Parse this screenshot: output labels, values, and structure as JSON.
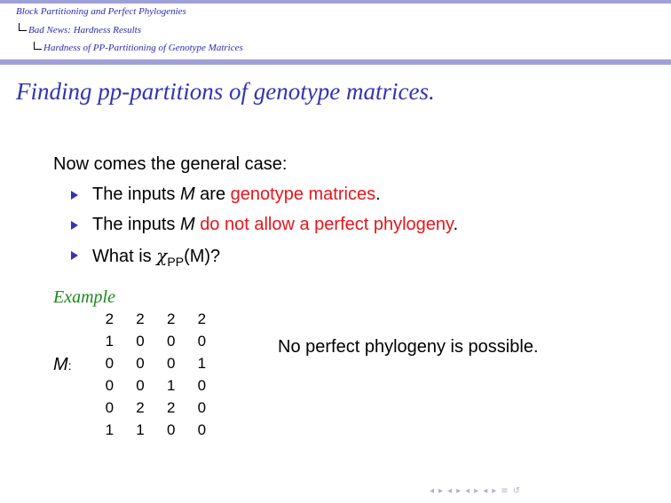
{
  "header": {
    "section": "Block Partitioning and Perfect Phylogenies",
    "subsection": "Bad News: Hardness Results",
    "subsubsection": "Hardness of PP-Partitioning of Genotype Matrices"
  },
  "colors": {
    "header_bar": "#a0a0d8",
    "title": "#3333b3",
    "highlight": "#e8141b",
    "example": "#1a8a1a"
  },
  "slide": {
    "title": "Finding pp-partitions of genotype matrices.",
    "intro": "Now comes the general case:",
    "bullets": [
      {
        "pre": "The inputs ",
        "var": "M",
        "mid": " are ",
        "red": "genotype matrices",
        "post": "."
      },
      {
        "pre": "The inputs ",
        "var": "M",
        "mid": " ",
        "red": "do not allow a perfect phylogeny",
        "post": "."
      },
      {
        "pre": "What is ",
        "chi": "χ",
        "sub": "PP",
        "post": "(M)?"
      }
    ],
    "example": {
      "label": "Example",
      "matrix_label": "M",
      "matrix_colon": ":",
      "matrix": [
        [
          "2",
          "2",
          "2",
          "2"
        ],
        [
          "1",
          "0",
          "0",
          "0"
        ],
        [
          "0",
          "0",
          "0",
          "1"
        ],
        [
          "0",
          "0",
          "1",
          "0"
        ],
        [
          "0",
          "2",
          "2",
          "0"
        ],
        [
          "1",
          "1",
          "0",
          "0"
        ]
      ],
      "note": "No perfect phylogeny is possible."
    }
  },
  "nav_icons": [
    "frame-prev-icon",
    "frame-next-icon",
    "subsection-prev-icon",
    "subsection-next-icon",
    "section-prev-icon",
    "section-next-icon",
    "slide-prev-icon",
    "slide-next-icon",
    "align-icon",
    "search-icon"
  ]
}
